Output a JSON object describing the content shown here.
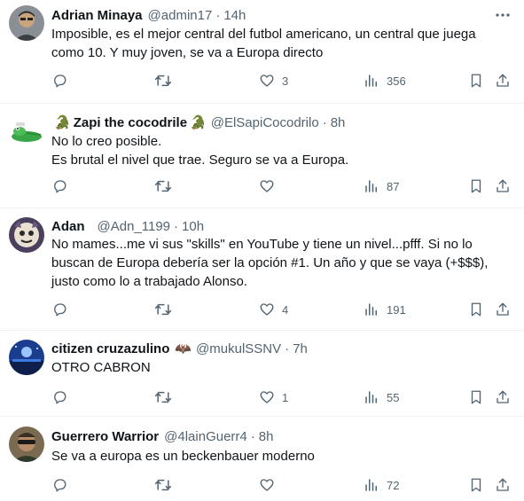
{
  "tweets": [
    {
      "name": "Adrian Minaya",
      "name_emoji_left": "",
      "name_emoji_right": "",
      "handle": "@admin17",
      "time": "14h",
      "lines": [
        "Imposible, es el mejor central del futbol americano, un central que juega",
        "como 10. Y muy joven, se va a Europa directo"
      ],
      "replies": "",
      "retweets": "",
      "likes": "3",
      "views": "356"
    },
    {
      "name": "Zapi the cocodrile",
      "name_emoji_left": "🐊",
      "name_emoji_right": "🐊",
      "handle": "@ElSapiCocodrilo",
      "time": "8h",
      "lines": [
        "No lo creo posible.",
        "Es brutal el nivel que trae. Seguro se va a Europa."
      ],
      "replies": "",
      "retweets": "",
      "likes": "",
      "views": "87"
    },
    {
      "name": "Adan",
      "name_emoji_left": "",
      "name_emoji_right": "",
      "handle": "@Adn_1199",
      "time": "10h",
      "lines": [
        "No mames...me vi sus \"skills\" en YouTube y tiene un nivel...pfff. Si no lo",
        "buscan de Europa debería ser la opción #1. Un año y que se vaya (+$$$),",
        "justo como lo a trabajado Alonso."
      ],
      "replies": "",
      "retweets": "",
      "likes": "4",
      "views": "191"
    },
    {
      "name": "citizen cruzazulino",
      "name_emoji_left": "",
      "name_emoji_right": "🦇",
      "handle": "@mukulSSNV",
      "time": "7h",
      "lines": [
        "OTRO CABRON"
      ],
      "replies": "",
      "retweets": "",
      "likes": "1",
      "views": "55"
    },
    {
      "name": "Guerrero Warrior",
      "name_emoji_left": "",
      "name_emoji_right": "",
      "handle": "@4lainGuerr4",
      "time": "8h",
      "lines": [
        "Se va a europa es un beckenbauer moderno"
      ],
      "replies": "",
      "retweets": "",
      "likes": "",
      "views": "72"
    }
  ],
  "icons": {
    "reply": "reply-icon",
    "retweet": "retweet-icon",
    "like": "heart-icon",
    "views": "views-icon",
    "bookmark": "bookmark-icon",
    "share": "share-icon",
    "more": "more-icon"
  },
  "colors": {
    "text": "#0f1419",
    "secondary": "#536471",
    "divider": "#eff3f4"
  }
}
